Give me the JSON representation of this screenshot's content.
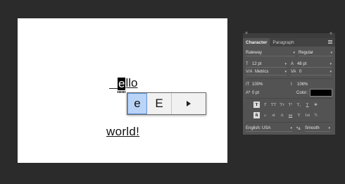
{
  "canvas": {
    "word_ello_selected": "e",
    "word_ello_rest": "llo",
    "word_world": "world!"
  },
  "alternates": {
    "glyphs": [
      "e",
      "E"
    ],
    "more_icon": "triangle-right-icon"
  },
  "panel": {
    "close_label": "×",
    "collapse_label": "«",
    "tabs": [
      "Character",
      "Paragraph"
    ],
    "font_family": "Raleway",
    "font_style": "Regular",
    "font_size": "12 pt",
    "leading": "48 pt",
    "kerning": "Metrics",
    "tracking": "0",
    "vertical_scale": "100%",
    "horizontal_scale": "106%",
    "baseline_shift": "0 pt",
    "color_label": "Color:",
    "color_value": "#000000",
    "type_buttons": [
      "T",
      "T",
      "TT",
      "Tт",
      "T¹",
      "T₁",
      "T",
      "T"
    ],
    "opentype_buttons": [
      "ﬁ",
      "ℴ",
      "st",
      "A",
      "aa",
      "T",
      "1st",
      "½"
    ],
    "language": "English: USA",
    "aa_label": "ªa",
    "anti_alias": "Smooth"
  }
}
